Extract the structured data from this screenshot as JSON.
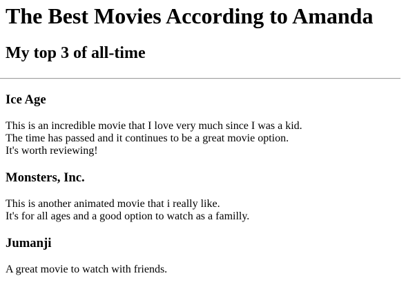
{
  "page": {
    "title": "The Best Movies According to Amanda",
    "subtitle": "My top 3 of all-time"
  },
  "movies": [
    {
      "name": "Ice Age",
      "lines": [
        "This is an incredible movie that I love very much since I was a kid.",
        "The time has passed and it continues to be a great movie option.",
        "It's worth reviewing!"
      ]
    },
    {
      "name": "Monsters, Inc.",
      "lines": [
        "This is another animated movie that i really like.",
        "It's for all ages and a good option to watch as a familly."
      ]
    },
    {
      "name": "Jumanji",
      "lines": [
        "A great movie to watch with friends."
      ]
    }
  ]
}
